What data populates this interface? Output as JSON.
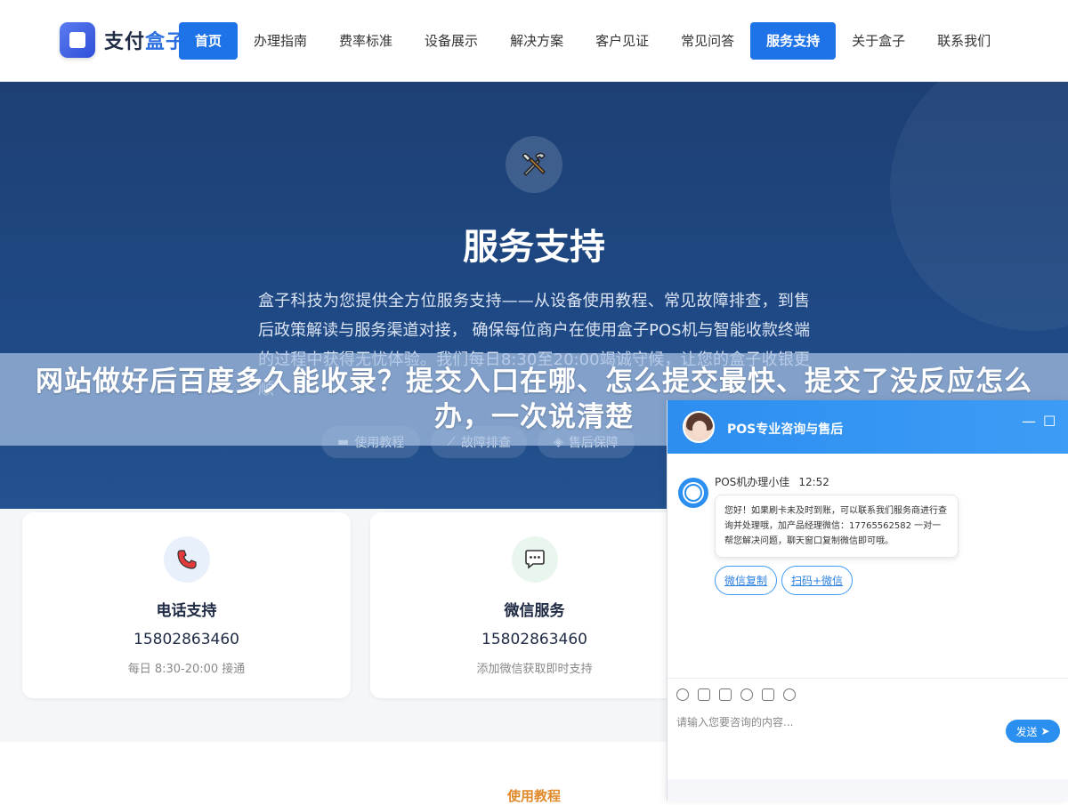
{
  "header": {
    "logo_text_a": "支付",
    "logo_text_b": "盒子",
    "nav": [
      "首页",
      "办理指南",
      "费率标准",
      "设备展示",
      "解决方案",
      "客户见证",
      "常见问答",
      "服务支持",
      "关于盒子",
      "联系我们"
    ]
  },
  "hero": {
    "icon": "tools-icon",
    "title": "服务支持",
    "description": "盒子科技为您提供全方位服务支持——从设备使用教程、常见故障排查，到售后政策解读与服务渠道对接， 确保每位商户在使用盒子POS机与智能收款终端的过程中获得无忧体验。我们每日8:30至20:00竭诚守候，让您的盒子收银更顺",
    "tags": [
      {
        "icon": "book-icon",
        "label": "使用教程"
      },
      {
        "icon": "wrench-icon",
        "label": "故障排查"
      },
      {
        "icon": "shield-icon",
        "label": "售后保障"
      }
    ]
  },
  "banner": {
    "title": "网站做好后百度多久能收录？提交入口在哪、怎么提交最快、提交了没反应怎么办，一次说清楚"
  },
  "cards": [
    {
      "icon": "phone-icon",
      "title": "电话支持",
      "value": "15802863460",
      "note": "每日 8:30-20:00 接通"
    },
    {
      "icon": "chat-icon",
      "title": "微信服务",
      "value": "15802863460",
      "note": "添加微信获取即时支持"
    }
  ],
  "section_label": "使用教程",
  "chat": {
    "title": "POS专业咨询与售后",
    "agent_name": "POS机办理小佳",
    "time": "12:52",
    "message": "您好！如果刷卡未及时到账，可以联系我们服务商进行查询并处理哦，加产品经理微信：17765562582 一对一帮您解决问题，聊天窗口复制微信即可哦。",
    "quick_replies": [
      "微信复制",
      "扫码+微信"
    ],
    "input_placeholder": "请输入您要咨询的内容...",
    "send_label": "发送"
  },
  "colors": {
    "brand_blue": "#1f73e8",
    "hero_bg": "#1f4a86",
    "accent_orange": "#e08a2b"
  }
}
